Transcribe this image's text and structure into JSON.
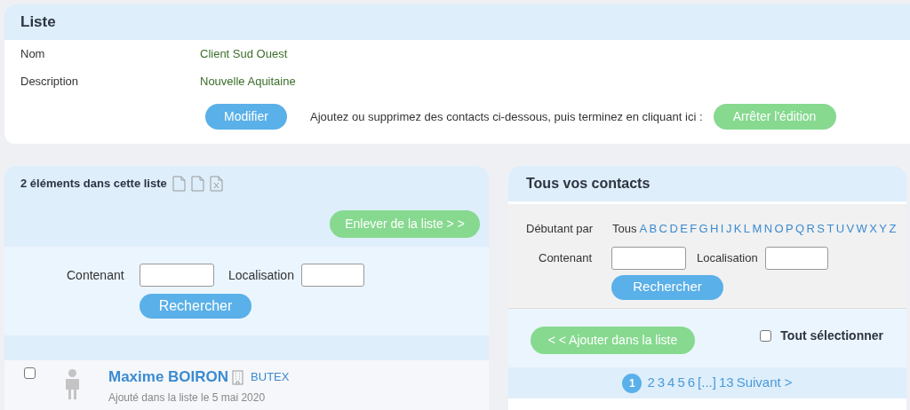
{
  "list_card": {
    "title": "Liste",
    "fields": [
      {
        "label": "Nom",
        "value": "Client Sud Ouest"
      },
      {
        "label": "Description",
        "value": "Nouvelle Aquitaine"
      }
    ],
    "edit_button": "Modifier",
    "hint": "Ajoutez ou supprimez des contacts ci-dessous, puis terminez en cliquant ici :",
    "stop_button": "Arrêter l'édition"
  },
  "left_panel": {
    "count_text": "2 éléments dans cette liste",
    "remove_button": "Enlever de la liste > >",
    "search": {
      "contains_label": "Contenant",
      "location_label": "Localisation",
      "button": "Rechercher"
    },
    "rows": [
      {
        "name": "Maxime BOIRON",
        "company": "BUTEX",
        "added": "Ajouté dans la liste le 5 mai 2020",
        "checked": false
      }
    ]
  },
  "right_panel": {
    "title": "Tous vos contacts",
    "starting_label": "Débutant par",
    "all_label": "Tous",
    "letters": [
      "A",
      "B",
      "C",
      "D",
      "E",
      "F",
      "G",
      "H",
      "I",
      "J",
      "K",
      "L",
      "M",
      "N",
      "O",
      "P",
      "Q",
      "R",
      "S",
      "T",
      "U",
      "V",
      "W",
      "X",
      "Y",
      "Z"
    ],
    "search": {
      "contains_label": "Contenant",
      "location_label": "Localisation",
      "button": "Rechercher"
    },
    "add_button": "< < Ajouter dans la liste",
    "select_all": {
      "label": "Tout sélectionner",
      "checked": false
    },
    "pages": [
      {
        "label": "1",
        "selected": true
      },
      {
        "label": "2",
        "selected": false
      },
      {
        "label": "3",
        "selected": false
      },
      {
        "label": "4",
        "selected": false
      },
      {
        "label": "5",
        "selected": false
      },
      {
        "label": "6",
        "selected": false
      }
    ],
    "ellipsis": "[...]",
    "last_page": "13",
    "next": "Suivant >"
  }
}
